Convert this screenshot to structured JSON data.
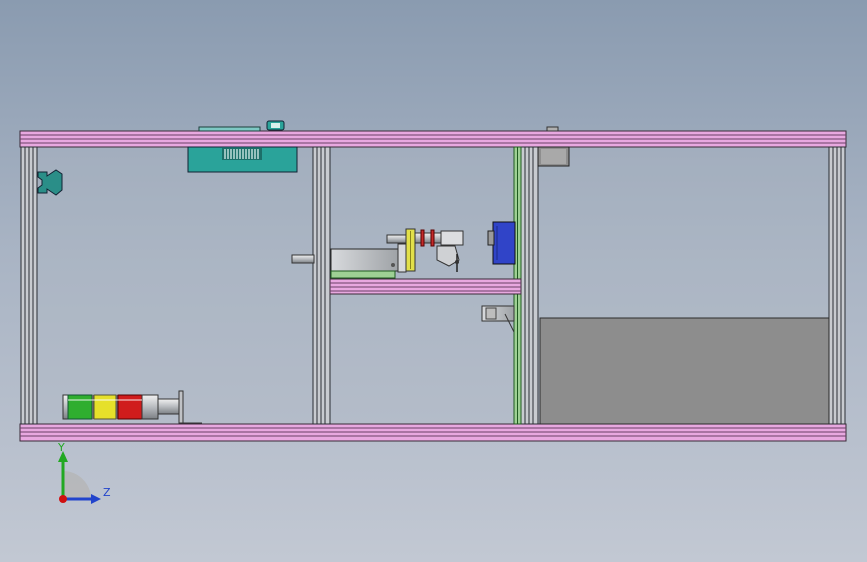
{
  "viewport": {
    "background_top": "#8a9bb0",
    "background_bottom": "#c2c8d3"
  },
  "frame": {
    "rail_color": "#e8a8e0",
    "rail_stripe": "#6a3f66",
    "post_color": "#c8cbd0",
    "post_stripe": "#2a2e33"
  },
  "components": {
    "panel_color": "#2aa39a",
    "motor_color": "#3044c8",
    "bracket_yellow": "#e2e04a",
    "plate_green": "#9ed094",
    "gray_box": "#8d8d8d",
    "tower_light_segments": [
      {
        "name": "green",
        "color": "#2fae2f"
      },
      {
        "name": "yellow",
        "color": "#e6e02a"
      },
      {
        "name": "red",
        "color": "#d01c1c"
      }
    ]
  },
  "triad": {
    "y_label": "Y",
    "z_label": "Z",
    "y_color": "#22a822",
    "z_color": "#2244cc",
    "origin_color": "#d01010"
  }
}
